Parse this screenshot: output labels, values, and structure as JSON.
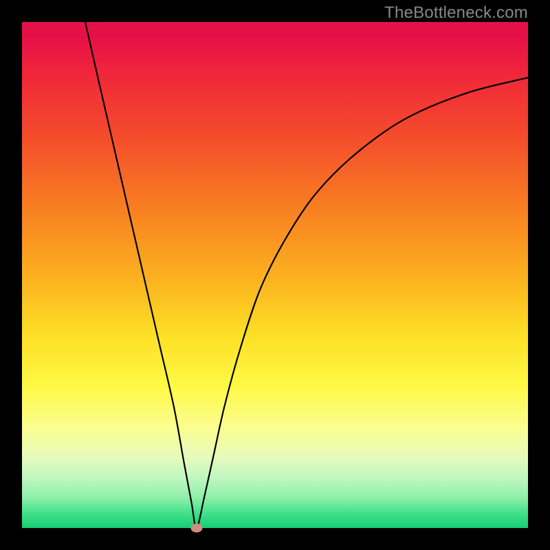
{
  "watermark": "TheBottleneck.com",
  "chart_data": {
    "type": "line",
    "title": "",
    "xlabel": "",
    "ylabel": "",
    "xlim": [
      0,
      100
    ],
    "ylim": [
      0,
      100
    ],
    "grid": false,
    "legend": false,
    "annotations": [],
    "min_marker": {
      "x": 34.5,
      "y": 0
    },
    "series": [
      {
        "name": "bottleneck-curve",
        "x": [
          12.5,
          15,
          18,
          21,
          24,
          27,
          30,
          32,
          33.5,
          34.5,
          36,
          38,
          40,
          43,
          47,
          52,
          58,
          66,
          76,
          88,
          100
        ],
        "values": [
          100,
          89,
          76,
          63,
          50,
          37,
          24,
          13,
          5,
          0,
          6,
          15,
          24,
          35,
          47,
          57,
          66,
          74,
          81,
          86,
          89
        ]
      }
    ],
    "background_gradient_stops": [
      {
        "pct": 0,
        "color": "#e61049"
      },
      {
        "pct": 10,
        "color": "#f0263a"
      },
      {
        "pct": 22,
        "color": "#f44a2c"
      },
      {
        "pct": 36,
        "color": "#f87c22"
      },
      {
        "pct": 50,
        "color": "#fbaf1f"
      },
      {
        "pct": 62,
        "color": "#fde025"
      },
      {
        "pct": 72,
        "color": "#fef945"
      },
      {
        "pct": 80,
        "color": "#fbfd8f"
      },
      {
        "pct": 86,
        "color": "#e6fbbb"
      },
      {
        "pct": 90,
        "color": "#c1f6c0"
      },
      {
        "pct": 94,
        "color": "#8ef0a8"
      },
      {
        "pct": 97,
        "color": "#44e08b"
      },
      {
        "pct": 100,
        "color": "#17cd74"
      }
    ]
  }
}
